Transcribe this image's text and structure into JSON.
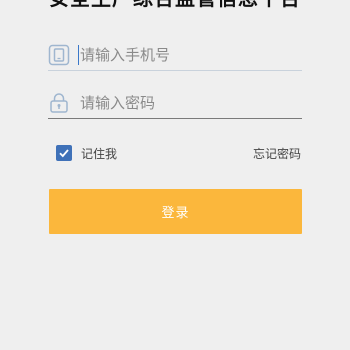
{
  "app": {
    "title": "安全生产综合监管信息平台"
  },
  "login_form": {
    "phone_placeholder": "请输入手机号",
    "password_placeholder": "请输入密码",
    "remember_me_label": "记住我",
    "remember_me_checked": true,
    "forgot_password_label": "忘记密码",
    "login_button_label": "登录"
  },
  "icons": {
    "phone": "phone-icon",
    "password": "lock-icon",
    "checkbox": "checkmark-icon"
  },
  "colors": {
    "accent": "#fbb73c",
    "checkbox": "#3f71b8",
    "icon": "#9fb6cf",
    "background": "#efefef"
  }
}
